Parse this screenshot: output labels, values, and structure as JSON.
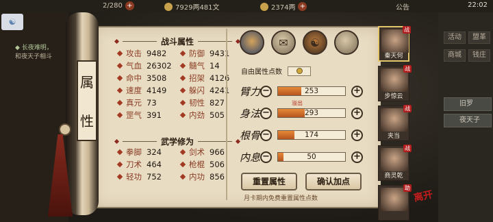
{
  "topbar": {
    "stamina": "2/280",
    "money": "7929两481文",
    "coins": "2374两",
    "announce": "公告",
    "time": "22:02"
  },
  "chat": {
    "line1": "◆ 长夜难明，",
    "line2": "和夜天子相斗"
  },
  "scroll": {
    "vertical_title": [
      "属",
      "性"
    ],
    "combat_title": "战斗属性",
    "martial_title": "武学修为",
    "combat_stats": [
      {
        "label": "攻击",
        "value": "9482"
      },
      {
        "label": "防御",
        "value": "9431"
      },
      {
        "label": "气血",
        "value": "26302"
      },
      {
        "label": "髓气",
        "value": "14"
      },
      {
        "label": "命中",
        "value": "3508"
      },
      {
        "label": "招架",
        "value": "4126"
      },
      {
        "label": "速度",
        "value": "4149"
      },
      {
        "label": "躲闪",
        "value": "4241"
      },
      {
        "label": "真元",
        "value": "73"
      },
      {
        "label": "韧性",
        "value": "827"
      },
      {
        "label": "罡气",
        "value": "391"
      },
      {
        "label": "内劲",
        "value": "505"
      }
    ],
    "martial_stats": [
      {
        "label": "拳脚",
        "value": "324"
      },
      {
        "label": "剑术",
        "value": "966"
      },
      {
        "label": "刀术",
        "value": "464"
      },
      {
        "label": "枪棍",
        "value": "506"
      },
      {
        "label": "轻功",
        "value": "752"
      },
      {
        "label": "内功",
        "value": "856"
      }
    ],
    "free_points_label": "自由属性点数",
    "overflow_label": "溢出",
    "attributes": [
      {
        "name": "臂力",
        "value": 253,
        "fill": 0.35
      },
      {
        "name": "身法",
        "value": 293,
        "fill": 0.4
      },
      {
        "name": "根骨",
        "value": 174,
        "fill": 0.24
      },
      {
        "name": "内息",
        "value": 50,
        "fill": 0.08
      }
    ],
    "reset_label": "重置属性",
    "confirm_label": "确认加点",
    "hint": "月卡期内免费重置属性点数"
  },
  "characters": [
    {
      "name": "秦天何",
      "tag": "战"
    },
    {
      "name": "步惊云",
      "tag": "战"
    },
    {
      "name": "夹当",
      "tag": "战"
    },
    {
      "name": "商灵乾",
      "tag": "战"
    },
    {
      "name": "",
      "tag": "助"
    }
  ],
  "right_menu": {
    "btn1": "活动",
    "btn2": "盟革",
    "btn3": "商城",
    "btn4": "钱庄",
    "tag1": "旧罗",
    "tag2": "夜天子"
  },
  "stamp": "离开"
}
